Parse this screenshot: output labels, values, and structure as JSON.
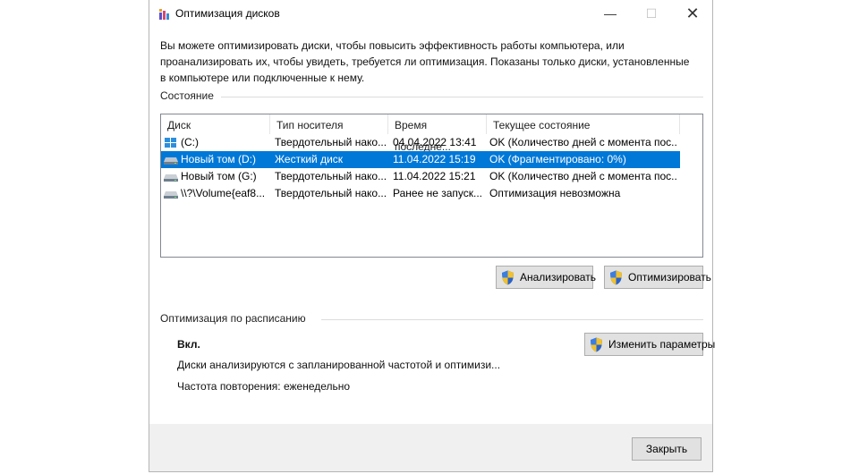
{
  "window": {
    "title": "Оптимизация дисков",
    "minimize_glyph": "—",
    "maximize_glyph": "☐",
    "close_glyph": "✕",
    "app_icon": "defrag-icon"
  },
  "description": "Вы можете оптимизировать диски, чтобы повысить эффективность работы  компьютера, или проанализировать их, чтобы увидеть, требуется ли оптимизация. Показаны только диски, установленные в компьютере или подключенные к нему.",
  "status_group": {
    "label": "Состояние",
    "columns": [
      "Диск",
      "Тип носителя",
      "Время последне...",
      "Текущее состояние"
    ],
    "rows": [
      {
        "disk": "(C:)",
        "icon": "windows-drive-icon",
        "media": "Твердотельный нако...",
        "time": "04.04.2022 13:41",
        "state": "OK (Количество дней с момента пос...",
        "selected": false
      },
      {
        "disk": "Новый том (D:)",
        "icon": "hard-drive-icon",
        "media": "Жесткий диск",
        "time": "11.04.2022 15:19",
        "state": "OK (Фрагментировано: 0%)",
        "selected": true
      },
      {
        "disk": "Новый том (G:)",
        "icon": "hard-drive-icon",
        "media": "Твердотельный нако...",
        "time": "11.04.2022 15:21",
        "state": "OK (Количество дней с момента пос...",
        "selected": false
      },
      {
        "disk": "\\\\?\\Volume{eaf8...",
        "icon": "hard-drive-icon",
        "media": "Твердотельный нако...",
        "time": "Ранее не запуск...",
        "state": "Оптимизация невозможна",
        "selected": false
      }
    ],
    "analyze_label": "Анализировать",
    "optimize_label": "Оптимизировать"
  },
  "schedule_group": {
    "label": "Оптимизация по расписанию",
    "status": "Вкл.",
    "details": "Диски анализируются с запланированной частотой и оптимизи...",
    "frequency": "Частота повторения: еженедельно",
    "change_label": "Изменить параметры"
  },
  "close_label": "Закрыть",
  "colors": {
    "selection": "#0078d7",
    "button_face": "#e1e1e1",
    "footer": "#f0f0f0"
  }
}
